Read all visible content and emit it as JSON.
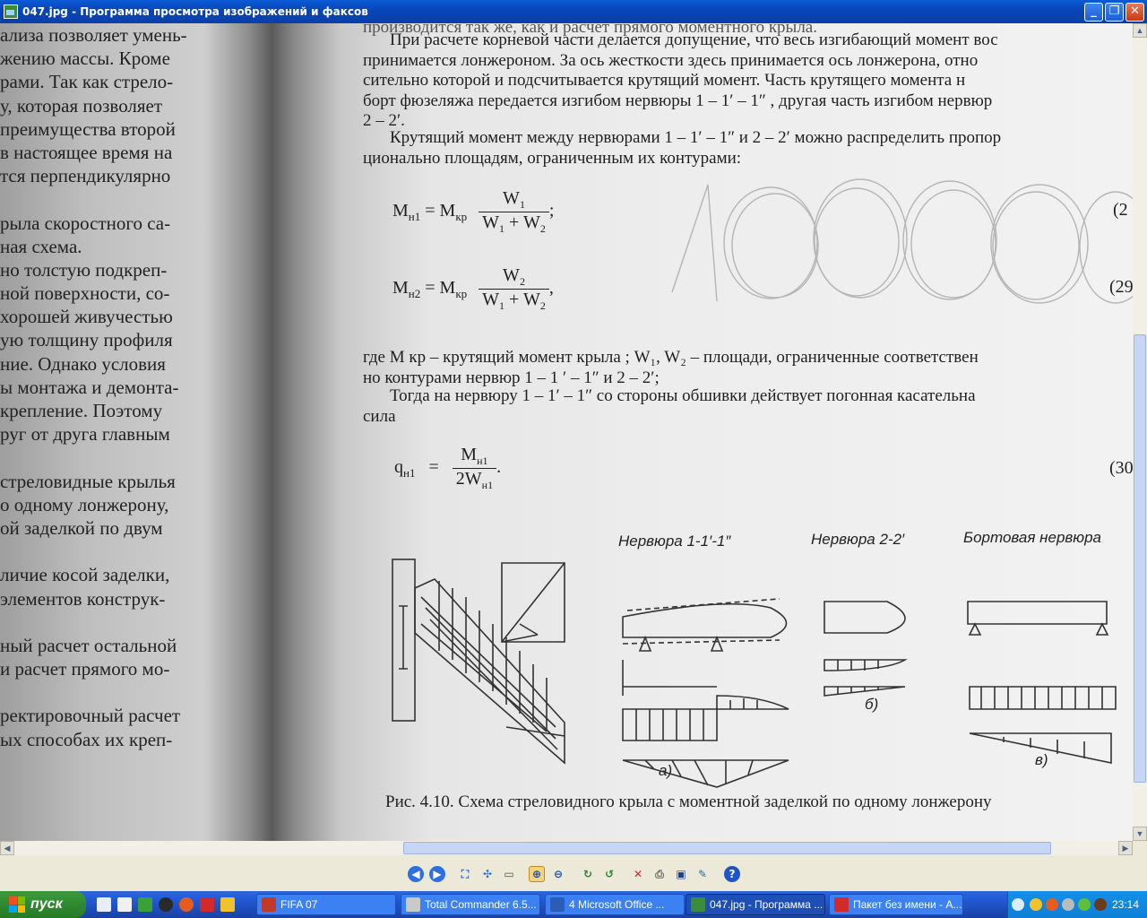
{
  "window": {
    "title": "047.jpg - Программа просмотра изображений и факсов",
    "buttons": {
      "minimize": "_",
      "maximize": "❐",
      "close": "✕"
    }
  },
  "left_page_lines": [
    "ализа позволяет умень-",
    "жению массы. Кроме",
    "рами. Так как стрело-",
    "у, которая позволяет",
    "преимущества второй",
    "в настоящее время на",
    "тся перпендикулярно",
    "",
    "рыла скоростного са-",
    "ная схема.",
    "но толстую подкреп-",
    "ной поверхности, со-",
    "хорошей живучестью",
    "ую толщину профиля",
    "ние. Однако условия",
    "ы монтажа и демонта-",
    "крепление. Поэтому",
    "руг от друга главным",
    "",
    "стреловидные крылья",
    "о одному лонжерону,",
    "ой заделкой по двум",
    "",
    "личие косой заделки,",
    "элементов конструк-",
    "",
    "ный расчет остальной",
    "и расчет прямого мо-",
    "",
    "ректировочный расчет",
    "ых способах их креп-"
  ],
  "right_page": {
    "line_top": "производится так же, как и расчет прямого моментного крыла.",
    "para1": [
      "При расчете корневой части делается допущение, что весь изгибающий момент вос",
      "принимается лонжероном. За ось жесткости здесь принимается ось лонжерона, отно",
      "сительно которой и подсчитывается крутящий момент. Часть крутящего момента н",
      "борт фюзеляжа передается изгибом нервюры 1 – 1′ – 1″ , другая часть изгибом нервюр",
      "2 – 2′."
    ],
    "para2": [
      "Крутящий момент между нервюрами 1 – 1′ – 1″ и 2 – 2′ можно распределить пропор",
      "ционально площадям, ограниченным их контурами:"
    ],
    "eq1": {
      "lhs": "M",
      "lhs_sub": "н1",
      "eq": "= M",
      "eq_sub": "кр",
      "num": "W",
      "num_sub": "1",
      "den": "W",
      "den_sub1": "1",
      "den_plus": "+ W",
      "den_sub2": "2",
      "end": ";",
      "no": "(2"
    },
    "eq2": {
      "lhs": "M",
      "lhs_sub": "н2",
      "eq": "= M",
      "eq_sub": "кр",
      "num": "W",
      "num_sub": "2",
      "den": "W",
      "den_sub1": "1",
      "den_plus": "+ W",
      "den_sub2": "2",
      "end": ",",
      "no": "(29"
    },
    "para3": [
      "где M кр – крутящий момент крыла ; W₁, W₂ – площади, ограниченные соответствен",
      "но контурами нервюр 1 – 1 ′ – 1″ и 2 – 2′;"
    ],
    "para4": [
      "Тогда на нервюру 1 – 1′ – 1″ со стороны обшивки действует погонная касательна",
      "сила"
    ],
    "eq3": {
      "lhs": "q",
      "lhs_sub": "н1",
      "eq": "=",
      "num": "M",
      "num_sub": "н1",
      "den": "2W",
      "den_sub": "н1",
      "end": ".",
      "no": "(30"
    },
    "figure_labels": {
      "rib1": "Нервюра 1-1′-1″",
      "rib2": "Нервюра 2-2′",
      "rib3": "Бортовая нервюра",
      "a": "а)",
      "b": "б)",
      "v": "в)"
    },
    "caption": "Рис. 4.10. Схема стреловидного крыла с моментной заделкой по одному лонжерону"
  },
  "toolbar": {
    "tools": [
      "prev-image",
      "next-image",
      "best-fit",
      "actual-size",
      "slideshow",
      "zoom-in",
      "zoom-out",
      "rotate-cw",
      "rotate-ccw",
      "delete",
      "print",
      "save",
      "edit",
      "help"
    ]
  },
  "taskbar": {
    "start_label": "пуск",
    "tasks": [
      {
        "label": "FIFA 07",
        "color": "#c0392b"
      },
      {
        "label": "Total Commander 6.5...",
        "color": "#c9c9c9"
      },
      {
        "label": "4 Microsoft Office ...",
        "color": "#2b5cb8"
      },
      {
        "label": "047.jpg - Программа ...",
        "color": "#3b8d3b"
      },
      {
        "label": "Пакет без имени - А...",
        "color": "#d22a2a"
      }
    ],
    "clock": "23:14"
  }
}
